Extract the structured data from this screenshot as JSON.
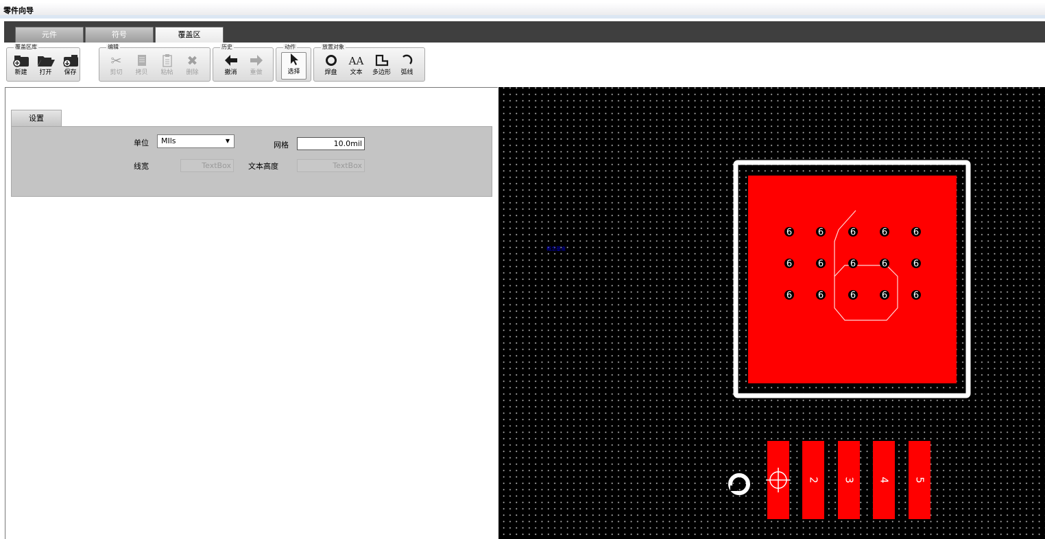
{
  "window": {
    "title": "零件向导"
  },
  "tabs": [
    {
      "label": "元件",
      "active": false
    },
    {
      "label": "符号",
      "active": false
    },
    {
      "label": "覆盖区",
      "active": true
    }
  ],
  "ribbon": {
    "groups": {
      "library": {
        "title": "覆盖区库",
        "buttons": [
          {
            "label": "新建",
            "icon": "new-folder-icon"
          },
          {
            "label": "打开",
            "icon": "open-folder-icon"
          },
          {
            "label": "保存",
            "icon": "save-folder-icon"
          }
        ]
      },
      "edit": {
        "title": "编辑",
        "buttons": [
          {
            "label": "剪切",
            "icon": "scissors-icon",
            "enabled": false
          },
          {
            "label": "拷贝",
            "icon": "copy-icon",
            "enabled": false
          },
          {
            "label": "粘帖",
            "icon": "paste-icon",
            "enabled": false
          },
          {
            "label": "删除",
            "icon": "delete-x-icon",
            "enabled": false
          }
        ]
      },
      "history": {
        "title": "历史",
        "buttons": [
          {
            "label": "撤消",
            "icon": "undo-arrow-icon",
            "enabled": true
          },
          {
            "label": "重做",
            "icon": "redo-arrow-icon",
            "enabled": false
          }
        ]
      },
      "action": {
        "title": "动作",
        "buttons": [
          {
            "label": "选择",
            "icon": "cursor-arrow-icon",
            "selected": true
          }
        ]
      },
      "place": {
        "title": "放置对象",
        "buttons": [
          {
            "label": "焊盘",
            "icon": "pad-circle-icon"
          },
          {
            "label": "文本",
            "icon": "text-icon"
          },
          {
            "label": "多边形",
            "icon": "polygon-icon"
          },
          {
            "label": "弧线",
            "icon": "arc-icon"
          }
        ]
      }
    }
  },
  "settings": {
    "tab_label": "设置",
    "unit_label": "单位",
    "unit_value": "MIls",
    "grid_label": "网格",
    "grid_value": "10.0mil",
    "line_width_label": "线宽",
    "line_width_placeholder": "TextBox",
    "text_height_label": "文本高度",
    "text_height_placeholder": "TextBox"
  },
  "canvas": {
    "colors": {
      "background": "#000000",
      "pad": "#ff0000",
      "outline": "#ffffff",
      "cursor_text": "#0000cc"
    },
    "grid_pin_label": "6",
    "pin_labels": [
      "2",
      "3",
      "4",
      "5"
    ],
    "origin_marker": "crosshair",
    "cursor_text": "概念基准"
  }
}
